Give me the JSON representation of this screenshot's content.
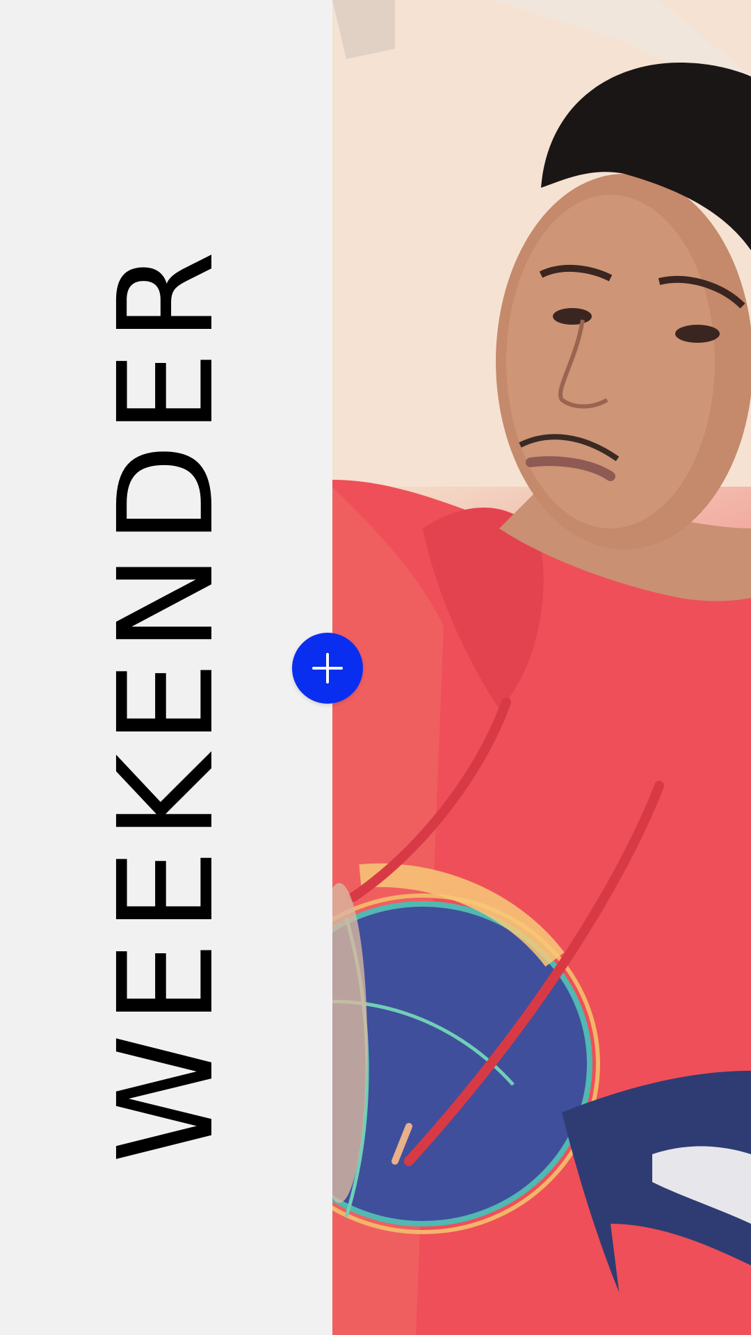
{
  "title": "WEEKENDER",
  "add_button": {
    "icon": "plus-icon",
    "color": "#0a2ef0"
  },
  "photo": {
    "subject": "person-photo"
  }
}
